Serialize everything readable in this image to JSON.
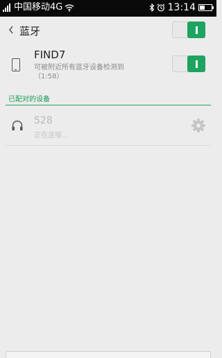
{
  "status_bar": {
    "carrier": "中国移动4G",
    "time": "13:14",
    "icons": [
      "signal-icon",
      "wifi-icon",
      "bluetooth-icon",
      "alarm-icon",
      "battery-icon"
    ]
  },
  "header": {
    "title": "蓝牙",
    "back_icon": "chevron-left-icon",
    "bluetooth_enabled": true
  },
  "this_device": {
    "name": "FIND7",
    "subtitle": "可被附近所有蓝牙设备检测到（1:58）",
    "visible": true,
    "icon": "phone-icon"
  },
  "paired_section": {
    "title": "已配对的设备",
    "devices": [
      {
        "name": "528",
        "status": "正在连接...",
        "icon": "headphones-icon",
        "settings_icon": "gear-icon"
      }
    ]
  },
  "colors": {
    "accent": "#1fa360",
    "status_bar": "#0a0a0a",
    "background": "#ececec"
  }
}
